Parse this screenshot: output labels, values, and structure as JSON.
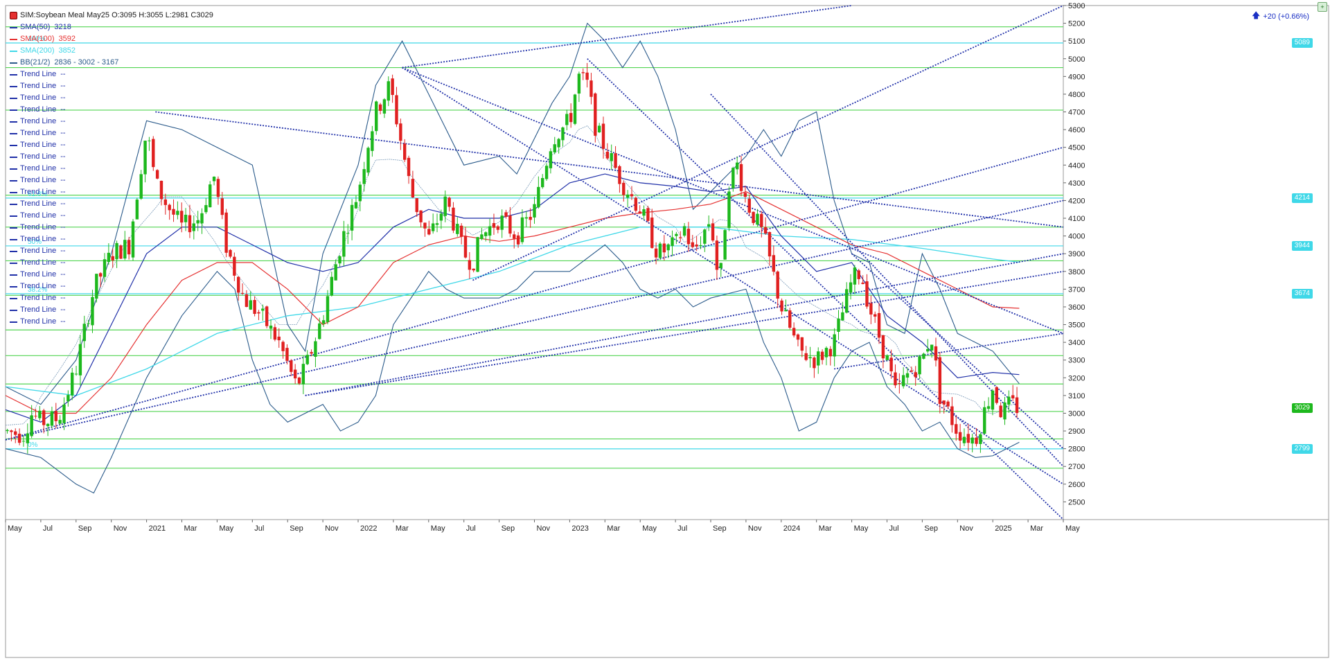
{
  "header": {
    "symbol_line": "SIM:Soybean Meal May25 O:3095 H:3055 L:2981 C3029",
    "change_text": "+20 (+0.66%)"
  },
  "legend": [
    {
      "label": "SMA(50)",
      "value": "3218",
      "color": "#1f2fa8"
    },
    {
      "label": "SMA(100)",
      "value": "3592",
      "color": "#e53030"
    },
    {
      "label": "SMA(200)",
      "value": "3852",
      "color": "#3fd8e8"
    },
    {
      "label": "BB(21/2)",
      "value": "2836 - 3002 - 3167",
      "color": "#2a5a8a"
    },
    {
      "label": "Trend Line",
      "value": "--",
      "color": "#1f2fa8"
    },
    {
      "label": "Trend Line",
      "value": "--",
      "color": "#1f2fa8"
    },
    {
      "label": "Trend Line",
      "value": "--",
      "color": "#1f2fa8"
    },
    {
      "label": "Trend Line",
      "value": "--",
      "color": "#1f2fa8"
    },
    {
      "label": "Trend Line",
      "value": "--",
      "color": "#1f2fa8"
    },
    {
      "label": "Trend Line",
      "value": "--",
      "color": "#1f2fa8"
    },
    {
      "label": "Trend Line",
      "value": "--",
      "color": "#1f2fa8"
    },
    {
      "label": "Trend Line",
      "value": "--",
      "color": "#1f2fa8"
    },
    {
      "label": "Trend Line",
      "value": "--",
      "color": "#1f2fa8"
    },
    {
      "label": "Trend Line",
      "value": "--",
      "color": "#1f2fa8"
    },
    {
      "label": "Trend Line",
      "value": "--",
      "color": "#1f2fa8"
    },
    {
      "label": "Trend Line",
      "value": "--",
      "color": "#1f2fa8"
    },
    {
      "label": "Trend Line",
      "value": "--",
      "color": "#1f2fa8"
    },
    {
      "label": "Trend Line",
      "value": "--",
      "color": "#1f2fa8"
    },
    {
      "label": "Trend Line",
      "value": "--",
      "color": "#1f2fa8"
    },
    {
      "label": "Trend Line",
      "value": "--",
      "color": "#1f2fa8"
    },
    {
      "label": "Trend Line",
      "value": "--",
      "color": "#1f2fa8"
    },
    {
      "label": "Trend Line",
      "value": "--",
      "color": "#1f2fa8"
    },
    {
      "label": "Trend Line",
      "value": "--",
      "color": "#1f2fa8"
    },
    {
      "label": "Trend Line",
      "value": "--",
      "color": "#1f2fa8"
    },
    {
      "label": "Trend Line",
      "value": "--",
      "color": "#1f2fa8"
    },
    {
      "label": "Trend Line",
      "value": "--",
      "color": "#1f2fa8"
    }
  ],
  "fib_labels": [
    "100%",
    "61.8%",
    "50%",
    "38.2%",
    "0%"
  ],
  "colors": {
    "up": "#1db81d",
    "down": "#e02020",
    "horizontal_green": "#52d452",
    "horizontal_cyan": "#3fd8e8",
    "trend": "#1f2fa8",
    "sma50": "#1f2fa8",
    "sma100": "#e53030",
    "sma200": "#3fd8e8",
    "bb": "#2a5a8a"
  },
  "chart_data": {
    "type": "candlestick",
    "title": "SIM:Soybean Meal May25",
    "ylim": [
      2400,
      5300
    ],
    "y_ticks": [
      "2500",
      "2600",
      "2700",
      "2800",
      "2900",
      "3000",
      "3100",
      "3200",
      "3300",
      "3400",
      "3500",
      "3600",
      "3700",
      "3800",
      "3900",
      "4000",
      "4100",
      "4200",
      "4300",
      "4400",
      "4500",
      "4600",
      "4700",
      "4800",
      "4900",
      "5000",
      "5100",
      "5200",
      "5300"
    ],
    "x_ticks": [
      "May",
      "Jul",
      "Sep",
      "Nov",
      "2021",
      "Mar",
      "May",
      "Jul",
      "Sep",
      "Nov",
      "2022",
      "Mar",
      "May",
      "Jul",
      "Sep",
      "Nov",
      "2023",
      "Mar",
      "May",
      "Jul",
      "Sep",
      "Nov",
      "2024",
      "Mar",
      "May",
      "Jul",
      "Sep",
      "Nov",
      "2025",
      "Mar",
      "May"
    ],
    "x_tick_months": [
      0,
      2,
      4,
      6,
      8,
      10,
      12,
      14,
      16,
      18,
      20,
      22,
      24,
      26,
      28,
      30,
      32,
      34,
      36,
      38,
      40,
      42,
      44,
      46,
      48,
      50,
      52,
      54,
      56,
      58,
      60
    ],
    "x_range_months": [
      0,
      60
    ],
    "price_tags": [
      {
        "value": 5089,
        "label": "5089",
        "color": "#3fd8e8"
      },
      {
        "value": 4214,
        "label": "4214",
        "color": "#3fd8e8"
      },
      {
        "value": 3944,
        "label": "3944",
        "color": "#3fd8e8"
      },
      {
        "value": 3674,
        "label": "3674",
        "color": "#3fd8e8"
      },
      {
        "value": 3029,
        "label": "3029",
        "color": "#1db81d"
      },
      {
        "value": 2799,
        "label": "2799",
        "color": "#3fd8e8"
      }
    ],
    "horizontal_levels": [
      {
        "value": 5180,
        "color": "green"
      },
      {
        "value": 5089,
        "color": "cyan"
      },
      {
        "value": 4950,
        "color": "green"
      },
      {
        "value": 4710,
        "color": "green"
      },
      {
        "value": 4214,
        "color": "cyan"
      },
      {
        "value": 4230,
        "color": "green"
      },
      {
        "value": 4050,
        "color": "green"
      },
      {
        "value": 3944,
        "color": "cyan"
      },
      {
        "value": 3860,
        "color": "green"
      },
      {
        "value": 3674,
        "color": "cyan"
      },
      {
        "value": 3665,
        "color": "green"
      },
      {
        "value": 3470,
        "color": "green"
      },
      {
        "value": 3325,
        "color": "green"
      },
      {
        "value": 3165,
        "color": "green"
      },
      {
        "value": 3010,
        "color": "green"
      },
      {
        "value": 2855,
        "color": "green"
      },
      {
        "value": 2799,
        "color": "cyan"
      },
      {
        "value": 2690,
        "color": "green"
      }
    ],
    "price_path": [
      [
        0,
        2900
      ],
      [
        1,
        2880
      ],
      [
        1.5,
        3000
      ],
      [
        2,
        2950
      ],
      [
        3,
        2970
      ],
      [
        4,
        3250
      ],
      [
        5,
        3700
      ],
      [
        6,
        3900
      ],
      [
        7,
        3950
      ],
      [
        8,
        4600
      ],
      [
        8.5,
        4300
      ],
      [
        9,
        4200
      ],
      [
        10,
        4050
      ],
      [
        11,
        4100
      ],
      [
        11.8,
        4350
      ],
      [
        12.5,
        3950
      ],
      [
        13.5,
        3650
      ],
      [
        14.5,
        3550
      ],
      [
        15.5,
        3400
      ],
      [
        16.5,
        3150
      ],
      [
        17,
        3250
      ],
      [
        18,
        3550
      ],
      [
        19,
        3950
      ],
      [
        20,
        4250
      ],
      [
        20.5,
        4500
      ],
      [
        21,
        4700
      ],
      [
        21.8,
        4850
      ],
      [
        22.5,
        4500
      ],
      [
        23,
        4250
      ],
      [
        24,
        3980
      ],
      [
        25,
        4200
      ],
      [
        26,
        3900
      ],
      [
        26.5,
        3850
      ],
      [
        27,
        4000
      ],
      [
        28,
        4100
      ],
      [
        29,
        4000
      ],
      [
        30,
        4150
      ],
      [
        31,
        4550
      ],
      [
        32,
        4650
      ],
      [
        32.5,
        4900
      ],
      [
        33,
        4850
      ],
      [
        33.5,
        4600
      ],
      [
        34,
        4500
      ],
      [
        35,
        4300
      ],
      [
        36,
        4150
      ],
      [
        37,
        3900
      ],
      [
        38,
        3950
      ],
      [
        38.5,
        4050
      ],
      [
        39,
        3900
      ],
      [
        40,
        4100
      ],
      [
        40.5,
        3700
      ],
      [
        41,
        4300
      ],
      [
        41.5,
        4400
      ],
      [
        42,
        4200
      ],
      [
        43,
        4000
      ],
      [
        44,
        3600
      ],
      [
        45,
        3350
      ],
      [
        46,
        3300
      ],
      [
        47,
        3400
      ],
      [
        48,
        3750
      ],
      [
        48.5,
        3800
      ],
      [
        49,
        3600
      ],
      [
        50,
        3300
      ],
      [
        50.5,
        3100
      ],
      [
        51,
        3200
      ],
      [
        52,
        3300
      ],
      [
        52.5,
        3450
      ],
      [
        53,
        3100
      ],
      [
        54,
        2900
      ],
      [
        55,
        2850
      ],
      [
        55.5,
        3000
      ],
      [
        56,
        3150
      ],
      [
        56.5,
        3000
      ],
      [
        57,
        3050
      ],
      [
        57.5,
        3029
      ]
    ],
    "sma50_path": [
      [
        0,
        3020
      ],
      [
        2,
        2950
      ],
      [
        4,
        3100
      ],
      [
        6,
        3500
      ],
      [
        8,
        3900
      ],
      [
        10,
        4050
      ],
      [
        12,
        4050
      ],
      [
        14,
        3950
      ],
      [
        16,
        3850
      ],
      [
        18,
        3800
      ],
      [
        20,
        3850
      ],
      [
        22,
        4050
      ],
      [
        24,
        4150
      ],
      [
        26,
        4100
      ],
      [
        28,
        4100
      ],
      [
        30,
        4150
      ],
      [
        32,
        4300
      ],
      [
        34,
        4350
      ],
      [
        36,
        4300
      ],
      [
        38,
        4280
      ],
      [
        40,
        4250
      ],
      [
        42,
        4280
      ],
      [
        44,
        4000
      ],
      [
        46,
        3800
      ],
      [
        48,
        3850
      ],
      [
        50,
        3550
      ],
      [
        52,
        3400
      ],
      [
        54,
        3200
      ],
      [
        56,
        3230
      ],
      [
        57.5,
        3218
      ]
    ],
    "sma100_path": [
      [
        0,
        3100
      ],
      [
        2,
        3000
      ],
      [
        4,
        3000
      ],
      [
        6,
        3200
      ],
      [
        8,
        3500
      ],
      [
        10,
        3750
      ],
      [
        12,
        3850
      ],
      [
        14,
        3850
      ],
      [
        16,
        3700
      ],
      [
        18,
        3500
      ],
      [
        20,
        3600
      ],
      [
        22,
        3850
      ],
      [
        24,
        3950
      ],
      [
        26,
        4000
      ],
      [
        28,
        3970
      ],
      [
        30,
        4000
      ],
      [
        32,
        4050
      ],
      [
        34,
        4100
      ],
      [
        36,
        4130
      ],
      [
        38,
        4150
      ],
      [
        40,
        4180
      ],
      [
        42,
        4250
      ],
      [
        44,
        4150
      ],
      [
        46,
        4050
      ],
      [
        48,
        3950
      ],
      [
        50,
        3900
      ],
      [
        52,
        3800
      ],
      [
        54,
        3700
      ],
      [
        56,
        3600
      ],
      [
        57.5,
        3592
      ]
    ],
    "sma200_path": [
      [
        0,
        3150
      ],
      [
        4,
        3100
      ],
      [
        8,
        3250
      ],
      [
        12,
        3450
      ],
      [
        16,
        3550
      ],
      [
        20,
        3600
      ],
      [
        24,
        3700
      ],
      [
        28,
        3800
      ],
      [
        32,
        3950
      ],
      [
        36,
        4050
      ],
      [
        40,
        4050
      ],
      [
        44,
        4000
      ],
      [
        48,
        3980
      ],
      [
        52,
        3930
      ],
      [
        56,
        3870
      ],
      [
        57.5,
        3852
      ]
    ],
    "bb_upper_path": [
      [
        0,
        3150
      ],
      [
        2,
        3050
      ],
      [
        4,
        3300
      ],
      [
        6,
        3900
      ],
      [
        8,
        4650
      ],
      [
        10,
        4600
      ],
      [
        12,
        4500
      ],
      [
        14,
        4400
      ],
      [
        16,
        3500
      ],
      [
        17,
        3350
      ],
      [
        18,
        3900
      ],
      [
        20,
        4400
      ],
      [
        21,
        4850
      ],
      [
        22.5,
        5100
      ],
      [
        24,
        4800
      ],
      [
        26,
        4400
      ],
      [
        28,
        4450
      ],
      [
        29,
        4350
      ],
      [
        31,
        4750
      ],
      [
        32,
        4900
      ],
      [
        33,
        5200
      ],
      [
        34,
        5100
      ],
      [
        35,
        4950
      ],
      [
        36,
        5100
      ],
      [
        37,
        4900
      ],
      [
        38,
        4600
      ],
      [
        39,
        4150
      ],
      [
        40,
        4250
      ],
      [
        41,
        4350
      ],
      [
        42,
        4450
      ],
      [
        43,
        4600
      ],
      [
        44,
        4450
      ],
      [
        45,
        4650
      ],
      [
        46,
        4700
      ],
      [
        47,
        4200
      ],
      [
        48,
        3900
      ],
      [
        49,
        3850
      ],
      [
        50,
        3500
      ],
      [
        51,
        3450
      ],
      [
        52,
        3900
      ],
      [
        53,
        3700
      ],
      [
        54,
        3450
      ],
      [
        55,
        3400
      ],
      [
        56,
        3350
      ],
      [
        57.5,
        3167
      ]
    ],
    "bb_lower_path": [
      [
        0,
        2800
      ],
      [
        2,
        2750
      ],
      [
        4,
        2600
      ],
      [
        5,
        2550
      ],
      [
        6,
        2750
      ],
      [
        8,
        3200
      ],
      [
        10,
        3550
      ],
      [
        12,
        3800
      ],
      [
        13,
        3700
      ],
      [
        14,
        3300
      ],
      [
        15,
        3050
      ],
      [
        16,
        2950
      ],
      [
        18,
        3050
      ],
      [
        19,
        2900
      ],
      [
        20,
        2950
      ],
      [
        21,
        3100
      ],
      [
        22,
        3500
      ],
      [
        24,
        3800
      ],
      [
        25,
        3700
      ],
      [
        26,
        3650
      ],
      [
        28,
        3650
      ],
      [
        29,
        3700
      ],
      [
        30,
        3800
      ],
      [
        32,
        3800
      ],
      [
        34,
        3950
      ],
      [
        35,
        3850
      ],
      [
        36,
        3700
      ],
      [
        37,
        3650
      ],
      [
        38,
        3700
      ],
      [
        39,
        3600
      ],
      [
        40,
        3650
      ],
      [
        42,
        3700
      ],
      [
        43,
        3400
      ],
      [
        44,
        3200
      ],
      [
        45,
        2900
      ],
      [
        46,
        2950
      ],
      [
        47,
        3200
      ],
      [
        48,
        3350
      ],
      [
        49,
        3400
      ],
      [
        50,
        3150
      ],
      [
        51,
        3050
      ],
      [
        52,
        2900
      ],
      [
        53,
        2950
      ],
      [
        54,
        2800
      ],
      [
        55,
        2750
      ],
      [
        56,
        2760
      ],
      [
        57.5,
        2836
      ]
    ],
    "trend_lines": [
      [
        0,
        2850,
        60,
        4500
      ],
      [
        0,
        2850,
        60,
        4200
      ],
      [
        17,
        3100,
        60,
        3900
      ],
      [
        17,
        3100,
        60,
        3800
      ],
      [
        8.5,
        4700,
        60,
        4050
      ],
      [
        22.5,
        4950,
        60,
        3450
      ],
      [
        22.5,
        4950,
        60,
        2600
      ],
      [
        33,
        5000,
        60,
        2400
      ],
      [
        40,
        4800,
        60,
        2700
      ],
      [
        48,
        3900,
        60,
        2800
      ],
      [
        47,
        3250,
        60,
        3450
      ],
      [
        26.5,
        3750,
        60,
        5300
      ],
      [
        22.5,
        4950,
        48,
        5300
      ]
    ]
  }
}
